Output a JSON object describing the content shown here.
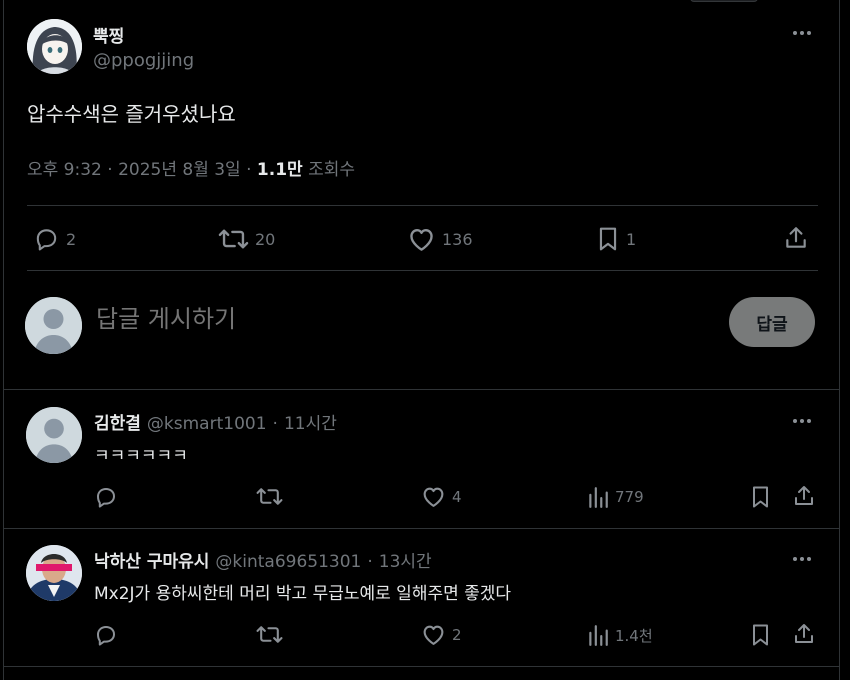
{
  "tweet": {
    "author": {
      "name": "뿍찡",
      "handle": "@ppogjjing"
    },
    "text": "압수수색은 즐거우셨나요",
    "time": "오후 9:32 · 2025년 8월 3일 · ",
    "views_count": "1.1만",
    "views_label": "조회수",
    "actions": {
      "replies": "2",
      "retweets": "20",
      "likes": "136",
      "bookmarks": "1"
    }
  },
  "composer": {
    "placeholder": "답글 게시하기",
    "button_label": "답글"
  },
  "replies": [
    {
      "name": "김한결",
      "handle": "@ksmart1001",
      "dot": "·",
      "time": "11시간",
      "text": "ㅋㅋㅋㅋㅋㅋ",
      "replies": "",
      "retweets": "",
      "likes": "4",
      "views": "779"
    },
    {
      "name": "낙하산 구마유시",
      "handle": "@kinta69651301",
      "dot": "·",
      "time": "13시간",
      "text": "Mx2J가 용하씨한테 머리 박고 무급노예로 일해주면 좋겠다",
      "replies": "",
      "retweets": "",
      "likes": "2",
      "views": "1.4천"
    }
  ],
  "icons": {
    "reply": "speech-bubble-icon",
    "retweet": "retweet-icon",
    "like": "heart-icon",
    "bookmark": "bookmark-icon",
    "share": "share-icon",
    "views": "bar-chart-icon",
    "more": "more-dots-icon"
  },
  "colors": {
    "background": "#000000",
    "text": "#e7e9ea",
    "muted": "#71767b",
    "border": "#2f3336",
    "button": "#787a7a"
  }
}
